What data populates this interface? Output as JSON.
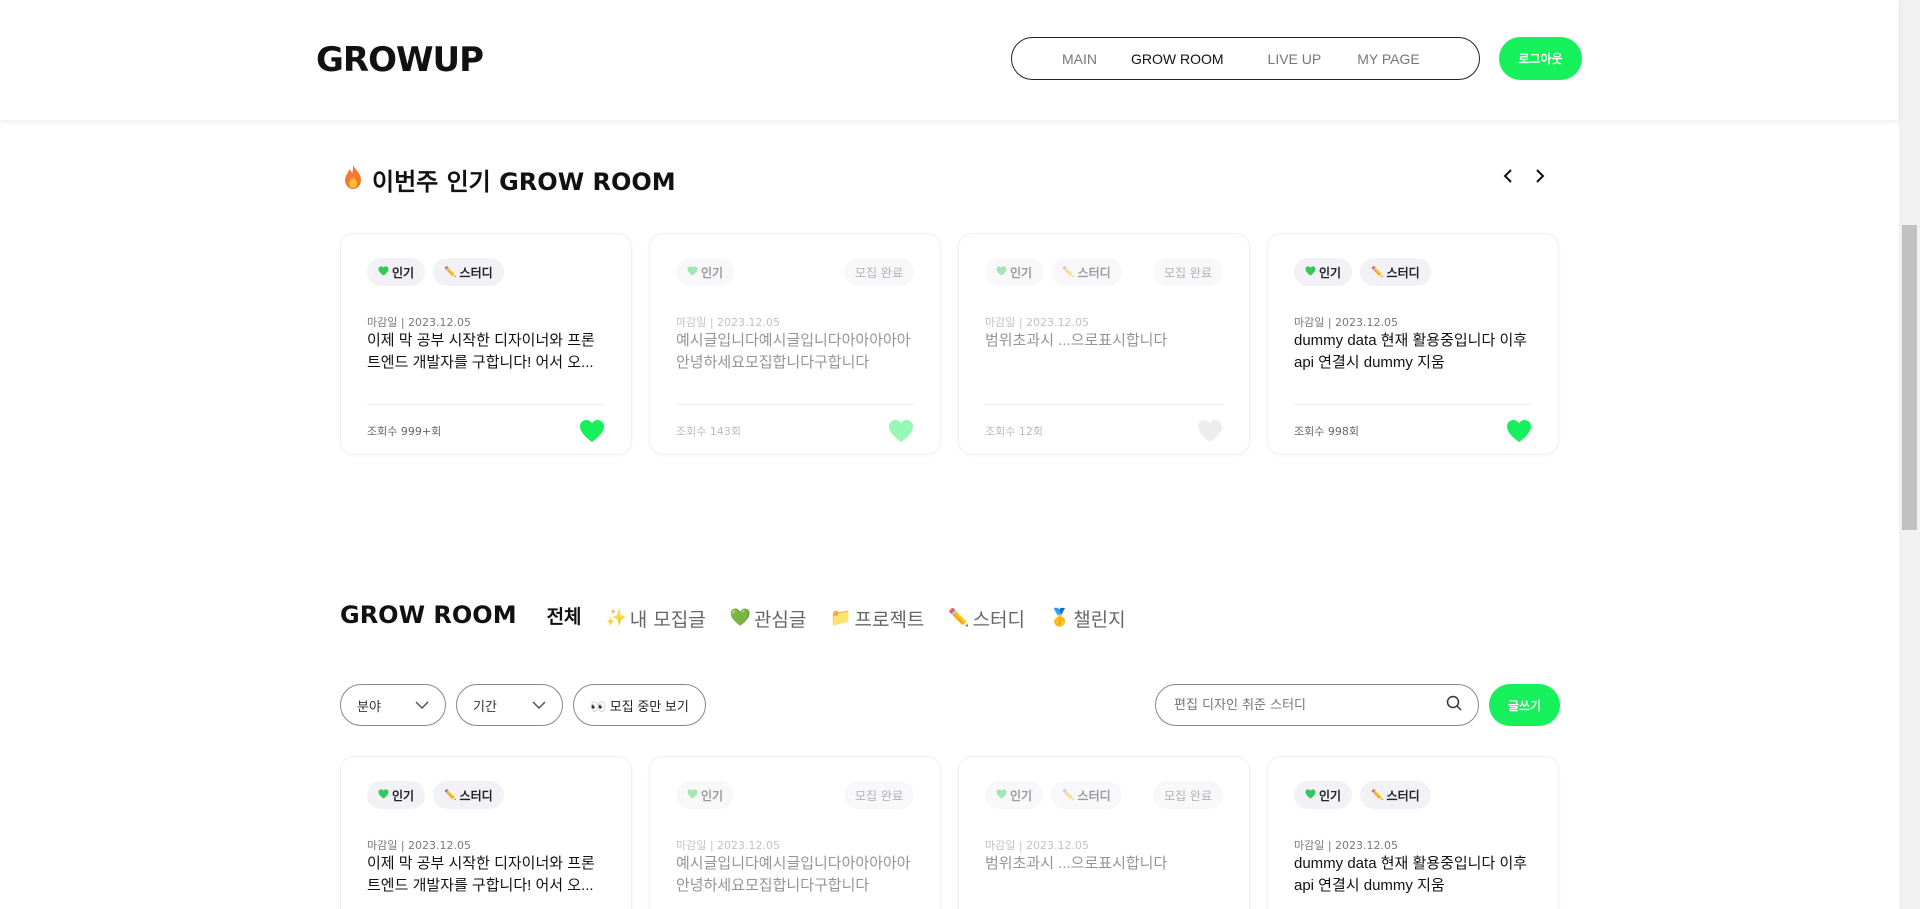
{
  "header": {
    "logo": "GROWUP",
    "nav": [
      "MAIN",
      "GROW ROOM",
      "LIVE UP",
      "MY PAGE"
    ],
    "active_nav": "GROW ROOM",
    "logout_label": "로그아웃"
  },
  "popular": {
    "title": "이번주 인기 GROW ROOM",
    "icon": "fire-icon",
    "cards": [
      {
        "tags": [
          "인기",
          "스터디"
        ],
        "status": "",
        "deadline": "마감일 | 2023.12.05",
        "title": "이제 막 공부 시작한 디자이너와 프론트엔드 개발자를 구합니다! 어서 오...",
        "views": "조회수 999+회",
        "liked": true,
        "faded": false
      },
      {
        "tags": [
          "인기"
        ],
        "status": "모집 완료",
        "deadline": "마감일 | 2023.12.05",
        "title": "예시글입니다예시글입니다아아아아아 안녕하세요모집합니다구합니다",
        "views": "조회수 143회",
        "liked": true,
        "faded": true
      },
      {
        "tags": [
          "인기",
          "스터디"
        ],
        "status": "모집 완료",
        "deadline": "마감일 | 2023.12.05",
        "title": "범위초과시 ...으로표시합니다",
        "views": "조회수 12회",
        "liked": false,
        "faded": true
      },
      {
        "tags": [
          "인기",
          "스터디"
        ],
        "status": "",
        "deadline": "마감일 | 2023.12.05",
        "title": "dummy data 현재 활용중입니다 이후 api 연결시 dummy 지움",
        "views": "조회수 998회",
        "liked": true,
        "faded": false
      }
    ]
  },
  "growroom": {
    "title": "GROW ROOM",
    "categories": [
      {
        "label": "전체",
        "icon": ""
      },
      {
        "label": "내 모집글",
        "icon": "✨"
      },
      {
        "label": "관심글",
        "icon": "💚"
      },
      {
        "label": "프로젝트",
        "icon": "📁"
      },
      {
        "label": "스터디",
        "icon": "✏️"
      },
      {
        "label": "챌린지",
        "icon": "🥇"
      }
    ],
    "filter_field": "분야",
    "filter_period": "기간",
    "toggle_label": "👀 모집 중만 보기",
    "search_placeholder": "편집 디자인 취준 스터디",
    "write_label": "글쓰기",
    "cards": [
      {
        "tags": [
          "인기",
          "스터디"
        ],
        "status": "",
        "deadline": "마감일 | 2023.12.05",
        "title": "이제 막 공부 시작한 디자이너와 프론트엔드 개발자를 구합니다! 어서 오...",
        "faded": false
      },
      {
        "tags": [
          "인기"
        ],
        "status": "모집 완료",
        "deadline": "마감일 | 2023.12.05",
        "title": "예시글입니다예시글입니다아아아아아 안녕하세요모집합니다구합니다",
        "faded": true
      },
      {
        "tags": [
          "인기",
          "스터디"
        ],
        "status": "모집 완료",
        "deadline": "마감일 | 2023.12.05",
        "title": "범위초과시 ...으로표시합니다",
        "faded": true
      },
      {
        "tags": [
          "인기",
          "스터디"
        ],
        "status": "",
        "deadline": "마감일 | 2023.12.05",
        "title": "dummy data 현재 활용중입니다 이후 api 연결시 dummy 지움",
        "faded": false
      }
    ]
  },
  "colors": {
    "accent": "#16f05a",
    "tag_bg": "#f1f1f6"
  }
}
